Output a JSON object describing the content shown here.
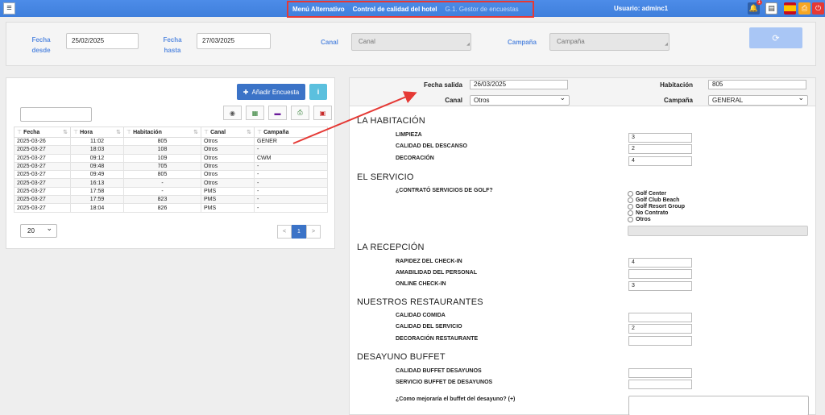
{
  "topbar": {
    "menu_glyph": "≡",
    "breadcrumbs": [
      "Menú Alternativo",
      "Control de calidad del hotel",
      "G.1. Gestor de encuestas"
    ],
    "user": "Usuario: adminc1",
    "notification_count": "1"
  },
  "filters": {
    "fecha_desde_label": "Fecha desde",
    "fecha_desde_value": "25/02/2025",
    "fecha_hasta_label": "Fecha hasta",
    "fecha_hasta_value": "27/03/2025",
    "canal_label": "Canal",
    "canal_placeholder": "Canal",
    "campana_label": "Campaña",
    "campana_placeholder": "Campaña"
  },
  "left": {
    "add_label": "Añadir Encuesta",
    "columns": [
      "Fecha",
      "Hora",
      "Habitación",
      "Canal",
      "Campaña"
    ],
    "rows": [
      [
        "2025-03-26",
        "11:02",
        "805",
        "Otros",
        "GENER"
      ],
      [
        "2025-03-27",
        "18:03",
        "108",
        "Otros",
        "-"
      ],
      [
        "2025-03-27",
        "09:12",
        "109",
        "Otros",
        "CWM"
      ],
      [
        "2025-03-27",
        "09:48",
        "705",
        "Otros",
        "-"
      ],
      [
        "2025-03-27",
        "09:49",
        "805",
        "Otros",
        "-"
      ],
      [
        "2025-03-27",
        "16:13",
        "-",
        "Otros",
        "-"
      ],
      [
        "2025-03-27",
        "17:58",
        "-",
        "PMS",
        "-"
      ],
      [
        "2025-03-27",
        "17:59",
        "823",
        "PMS",
        "-"
      ],
      [
        "2025-03-27",
        "18:04",
        "826",
        "PMS",
        "-"
      ]
    ],
    "page_size": "20",
    "pager": {
      "prev": "<",
      "current": "1",
      "next": ">"
    }
  },
  "right": {
    "fecha_salida_label": "Fecha salida",
    "fecha_salida_value": "26/03/2025",
    "habitacion_label": "Habitación",
    "habitacion_value": "805",
    "canal_label": "Canal",
    "canal_value": "Otros",
    "campana_label": "Campaña",
    "campana_value": "GENERAL",
    "sections": {
      "habitacion": "LA HABITACIÓN",
      "servicio": "EL SERVICIO",
      "recepcion": "LA RECEPCIÓN",
      "restaurantes": "NUESTROS RESTAURANTES",
      "desayuno": "DESAYUNO BUFFET"
    },
    "questions": {
      "limpieza": {
        "label": "LIMPIEZA",
        "value": "3"
      },
      "descanso": {
        "label": "CALIDAD DEL DESCANSO",
        "value": "2"
      },
      "decoracion": {
        "label": "DECORACIÓN",
        "value": "4"
      },
      "golf": {
        "label": "¿CONTRATÓ SERVICIOS DE GOLF?",
        "options": [
          "Golf Center",
          "Golf Club Beach",
          "Golf Resort Group",
          "No Contrato",
          "Otros"
        ]
      },
      "rapidez": {
        "label": "RAPIDEZ DEL CHECK-IN",
        "value": "4"
      },
      "amabilidad": {
        "label": "AMABILIDAD DEL PERSONAL",
        "value": ""
      },
      "online": {
        "label": "ONLINE CHECK-IN",
        "value": "3"
      },
      "comida": {
        "label": "CALIDAD COMIDA",
        "value": ""
      },
      "servicio_rest": {
        "label": "CALIDAD DEL SERVICIO",
        "value": "2"
      },
      "deco_rest": {
        "label": "DECORACIÓN RESTAURANTE",
        "value": ""
      },
      "buffet_calidad": {
        "label": "CALIDAD BUFFET DESAYUNOS",
        "value": ""
      },
      "buffet_servicio": {
        "label": "SERVICIO BUFFET DE DESAYUNOS",
        "value": ""
      },
      "mejoraria": {
        "label": "¿Como mejoraría el buffet del desayuno? (+)",
        "value": ""
      }
    }
  },
  "colors": {
    "accent": "#3b73c7",
    "topbar": "#4d8ce8",
    "label_blue": "#5b8de0",
    "highlight_red": "#e53935"
  }
}
